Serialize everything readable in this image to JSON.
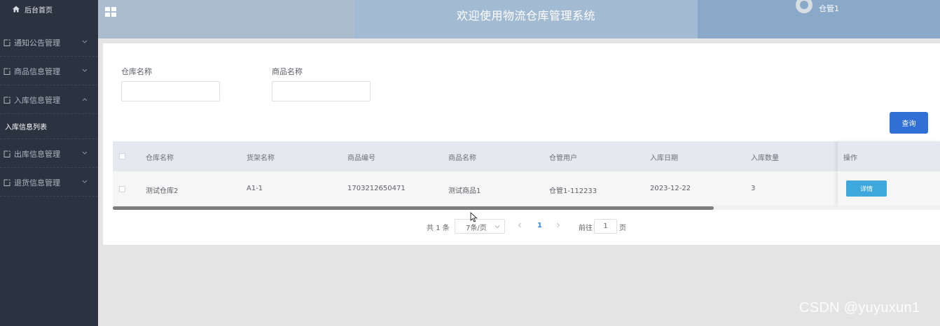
{
  "sidebar": {
    "home_label": "后台首页",
    "items": [
      {
        "label": "通知公告管理"
      },
      {
        "label": "商品信息管理"
      },
      {
        "label": "入库信息管理"
      },
      {
        "label": "出库信息管理"
      },
      {
        "label": "退货信息管理"
      }
    ],
    "sub_item_label": "入库信息列表"
  },
  "header": {
    "title": "欢迎使用物流仓库管理系统",
    "user_name": "仓管1"
  },
  "search": {
    "warehouse_label": "仓库名称",
    "warehouse_value": "",
    "product_label": "商品名称",
    "product_value": "",
    "query_button": "查询"
  },
  "table": {
    "columns": [
      "仓库名称",
      "货架名称",
      "商品编号",
      "商品名称",
      "仓管用户",
      "入库日期",
      "入库数量",
      "操作"
    ],
    "rows": [
      {
        "warehouse": "测试仓库2",
        "shelf": "A1-1",
        "product_code": "1703212650471",
        "product_name": "测试商品1",
        "keeper": "仓管1-112233",
        "date": "2023-12-22",
        "quantity": "3",
        "action": "详情"
      }
    ]
  },
  "pagination": {
    "total": "共 1 条",
    "page_size": "7条/页",
    "current_page": "1",
    "goto_label": "前往",
    "goto_value": "1",
    "page_unit": "页"
  },
  "watermark": "CSDN @yuyuxun1",
  "colors": {
    "sidebar_bg": "#2b3240",
    "header_bg": "#aabccd",
    "primary": "#2f6fd6",
    "detail_button": "#3ea8dc"
  }
}
